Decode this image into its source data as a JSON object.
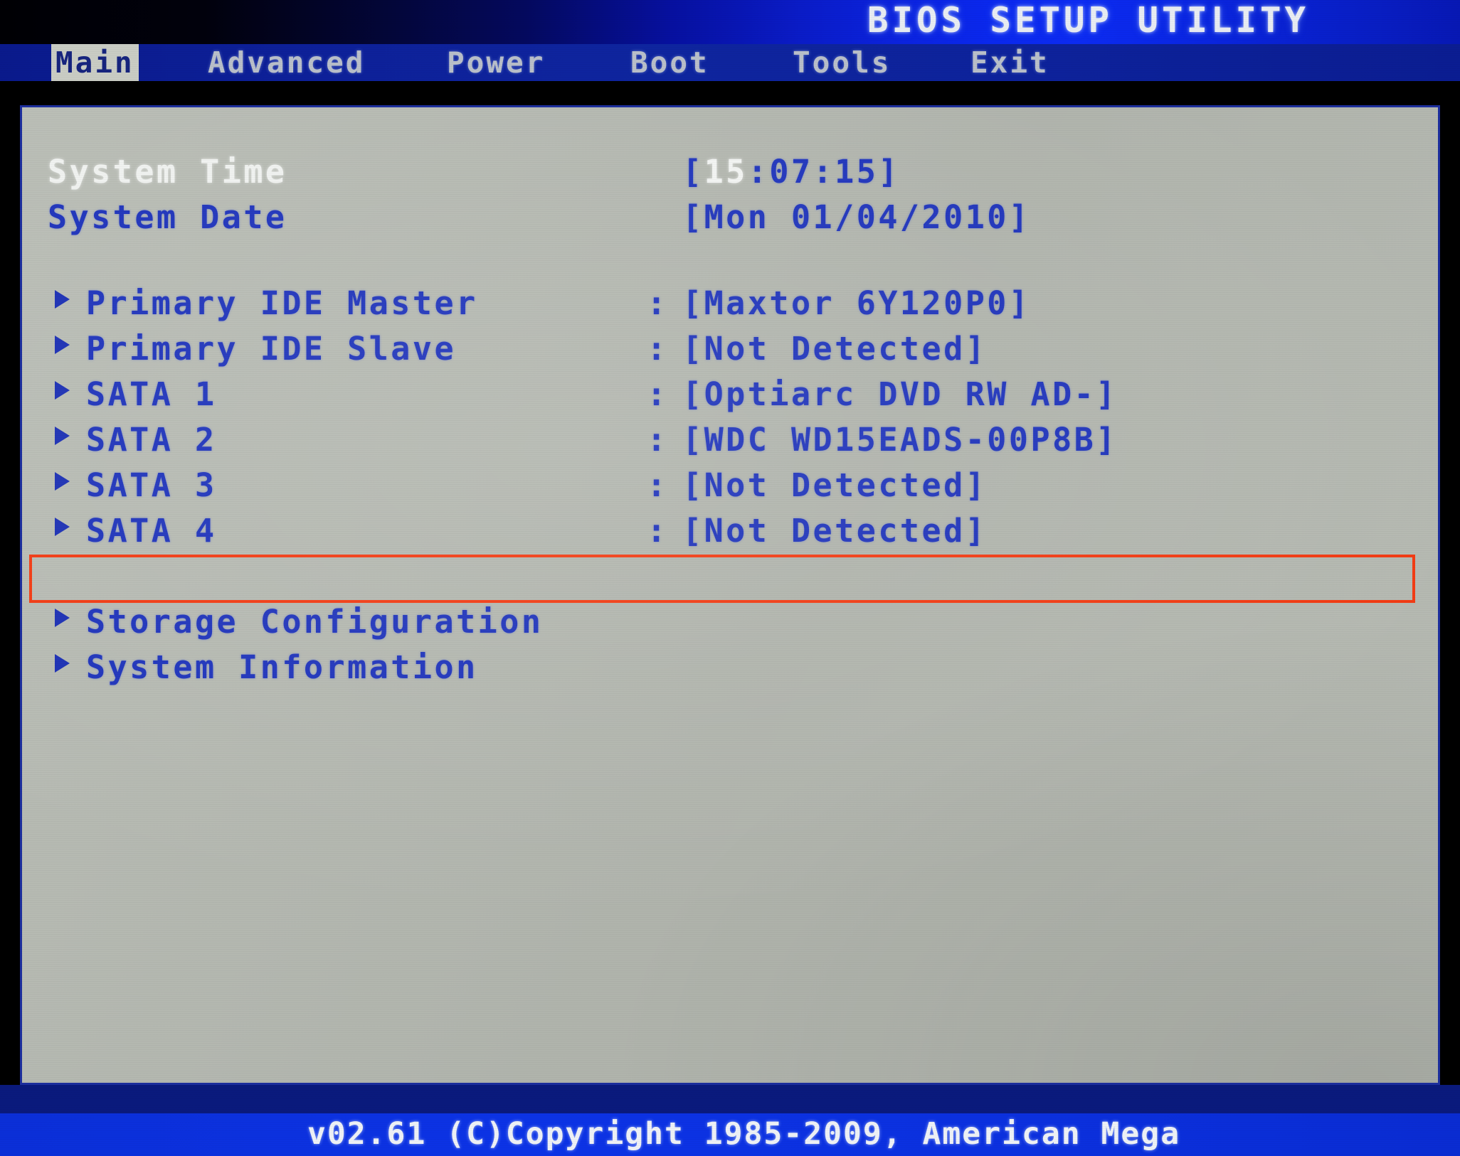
{
  "header": {
    "title": "BIOS SETUP UTILITY"
  },
  "menu": {
    "items": [
      {
        "label": "Main",
        "active": true
      },
      {
        "label": "Advanced",
        "active": false
      },
      {
        "label": "Power",
        "active": false
      },
      {
        "label": "Boot",
        "active": false
      },
      {
        "label": "Tools",
        "active": false
      },
      {
        "label": "Exit",
        "active": false
      }
    ]
  },
  "main": {
    "settings": [
      {
        "label": "System Time",
        "label_style": "white",
        "has_marker": false,
        "has_colon": false,
        "value_prefix": "[",
        "value_selected": "15",
        "value_suffix": ":07:15]"
      },
      {
        "label": "System Date",
        "label_style": "blue",
        "has_marker": false,
        "has_colon": false,
        "value": "[Mon 01/04/2010]"
      }
    ],
    "drives": [
      {
        "label": "Primary IDE Master",
        "value": "[Maxtor 6Y120P0]",
        "highlighted": false
      },
      {
        "label": "Primary IDE Slave",
        "value": "[Not Detected]",
        "highlighted": false
      },
      {
        "label": "SATA 1",
        "value": "[Optiarc DVD RW AD-]",
        "highlighted": false
      },
      {
        "label": "SATA 2",
        "value": "[WDC WD15EADS-00P8B]",
        "highlighted": true
      },
      {
        "label": "SATA 3",
        "value": "[Not Detected]",
        "highlighted": false
      },
      {
        "label": "SATA 4",
        "value": "[Not Detected]",
        "highlighted": false
      }
    ],
    "submenus": [
      {
        "label": "Storage Configuration"
      },
      {
        "label": "System Information"
      }
    ],
    "colon": ":"
  },
  "footer": {
    "copyright": "v02.61  (C)Copyright 1985-2009, American Mega"
  },
  "colors": {
    "panel_bg": "#b6bab2",
    "text_blue": "#1e33bb",
    "text_white": "#f0f2f0",
    "menu_bar_blue": "#0d2099",
    "footer_blue": "#0c33e6",
    "annotation_red": "#f23a12",
    "active_tab_bg": "#c9ccc4"
  }
}
